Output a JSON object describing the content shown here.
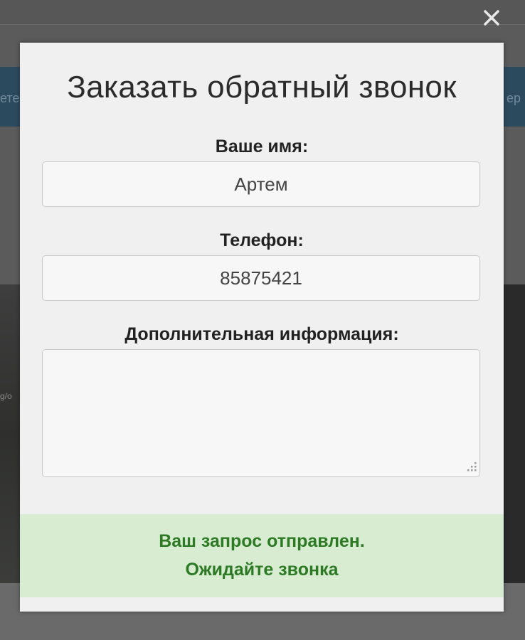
{
  "modal": {
    "title": "Заказать обратный звонок",
    "fields": {
      "name": {
        "label": "Ваше имя:",
        "value": "Артем"
      },
      "phone": {
        "label": "Телефон:",
        "value": "85875421"
      },
      "info": {
        "label": "Дополнительная информация:",
        "value": ""
      }
    },
    "success": {
      "line1": "Ваш запрос отправлен.",
      "line2": "Ожидайте звонка"
    },
    "close_icon": "close-icon"
  },
  "background": {
    "nav_left": "ете",
    "nav_right": "ер",
    "url_fragment": "g/o"
  },
  "colors": {
    "success_text": "#2c7a23",
    "success_bg": "#d8ecd2",
    "modal_bg": "#f0f0f0"
  }
}
